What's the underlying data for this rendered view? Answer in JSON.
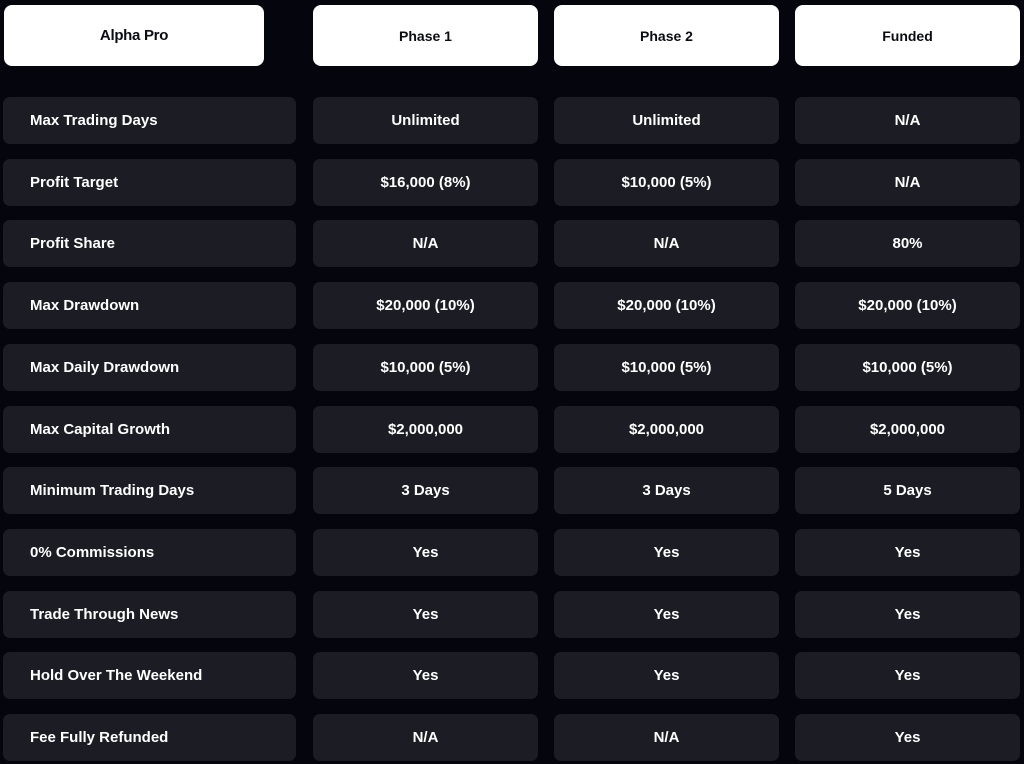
{
  "header": {
    "brand": "Alpha Pro",
    "columns": [
      "Phase 1",
      "Phase 2",
      "Funded"
    ]
  },
  "rows": [
    {
      "label": "Max Trading Days",
      "values": [
        "Unlimited",
        "Unlimited",
        "N/A"
      ]
    },
    {
      "label": "Profit Target",
      "values": [
        "$16,000 (8%)",
        "$10,000 (5%)",
        "N/A"
      ]
    },
    {
      "label": "Profit Share",
      "values": [
        "N/A",
        "N/A",
        "80%"
      ]
    },
    {
      "label": "Max Drawdown",
      "values": [
        "$20,000 (10%)",
        "$20,000 (10%)",
        "$20,000 (10%)"
      ]
    },
    {
      "label": "Max Daily Drawdown",
      "values": [
        "$10,000 (5%)",
        "$10,000 (5%)",
        "$10,000 (5%)"
      ]
    },
    {
      "label": "Max Capital Growth",
      "values": [
        "$2,000,000",
        "$2,000,000",
        "$2,000,000"
      ]
    },
    {
      "label": "Minimum Trading Days",
      "values": [
        "3 Days",
        "3 Days",
        "5 Days"
      ]
    },
    {
      "label": "0% Commissions",
      "values": [
        "Yes",
        "Yes",
        "Yes"
      ]
    },
    {
      "label": "Trade Through News",
      "values": [
        "Yes",
        "Yes",
        "Yes"
      ]
    },
    {
      "label": "Hold Over The Weekend",
      "values": [
        "Yes",
        "Yes",
        "Yes"
      ]
    },
    {
      "label": "Fee Fully Refunded",
      "values": [
        "N/A",
        "N/A",
        "Yes"
      ]
    }
  ]
}
